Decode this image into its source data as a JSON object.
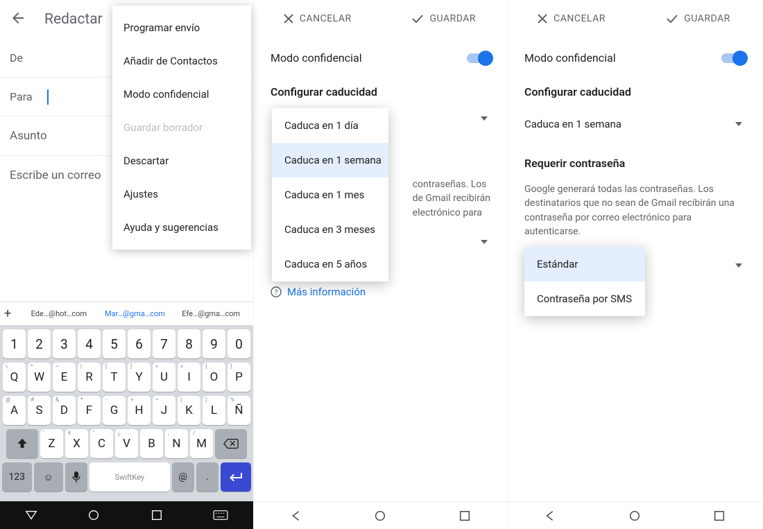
{
  "panel1": {
    "title": "Redactar",
    "rows": {
      "from": "De",
      "to": "Para",
      "subject": "Asunto",
      "body": "Escribe un correo"
    },
    "menu": {
      "schedule": "Programar envío",
      "contacts": "Añadir de Contactos",
      "confidential": "Modo confidencial",
      "saveDraft": "Guardar borrador",
      "discard": "Descartar",
      "settings": "Ajustes",
      "help": "Ayuda y sugerencias"
    },
    "suggestions": {
      "s1": "Ede…@hot…com",
      "s2": "Mar…@gma…com",
      "s3": "Efe…@gma…com"
    },
    "keyboard": {
      "row1": [
        "1",
        "2",
        "3",
        "4",
        "5",
        "6",
        "7",
        "8",
        "9",
        "0"
      ],
      "row2": [
        [
          "\\",
          "Q"
        ],
        [
          "^",
          "W"
        ],
        [
          "~",
          "E"
        ],
        [
          "|",
          "R"
        ],
        [
          "[",
          "T"
        ],
        [
          "]",
          "Y"
        ],
        [
          "<",
          "U"
        ],
        [
          ">",
          "I"
        ],
        [
          "{",
          "O"
        ],
        [
          "}",
          "P"
        ]
      ],
      "row3": [
        [
          "@",
          "A"
        ],
        [
          "#",
          "S"
        ],
        [
          "&",
          "D"
        ],
        [
          "*",
          "F"
        ],
        [
          "-",
          "G"
        ],
        [
          "+",
          "H"
        ],
        [
          "=",
          "J"
        ],
        [
          "(",
          "K"
        ],
        [
          ")",
          "L"
        ],
        [
          "%",
          "Ñ"
        ]
      ],
      "row4": [
        [
          "'",
          "Z"
        ],
        [
          "€",
          "X"
        ],
        [
          "\"",
          "C"
        ],
        [
          "¿",
          "V"
        ],
        [
          ":",
          "B"
        ],
        [
          ";",
          "N"
        ],
        [
          "/",
          "M"
        ]
      ],
      "n123": "123",
      "space": "SwiftKey"
    }
  },
  "panel2": {
    "cancel": "CANCELAR",
    "save": "GUARDAR",
    "mode": "Modo confidencial",
    "expiryTitle": "Configurar caducidad",
    "options": {
      "o1": "Caduca en 1 día",
      "o2": "Caduca en 1 semana",
      "o3": "Caduca en 1 mes",
      "o4": "Caduca en 3 meses",
      "o5": "Caduca en 5 años"
    },
    "desc1": "contraseñas. Los",
    "desc2": "de Gmail recibirán",
    "desc3": "electrónico para",
    "more": "Más información"
  },
  "panel3": {
    "cancel": "CANCELAR",
    "save": "GUARDAR",
    "mode": "Modo confidencial",
    "expiryTitle": "Configurar caducidad",
    "expiryValue": "Caduca en 1 semana",
    "passTitle": "Requerir contraseña",
    "passDesc": "Google generará todas las contraseñas. Los destinatarios que no sean de Gmail recibirán una contraseña por correo electrónico para autenticarse.",
    "opt1": "Estándar",
    "opt2": "Contraseña por SMS"
  }
}
